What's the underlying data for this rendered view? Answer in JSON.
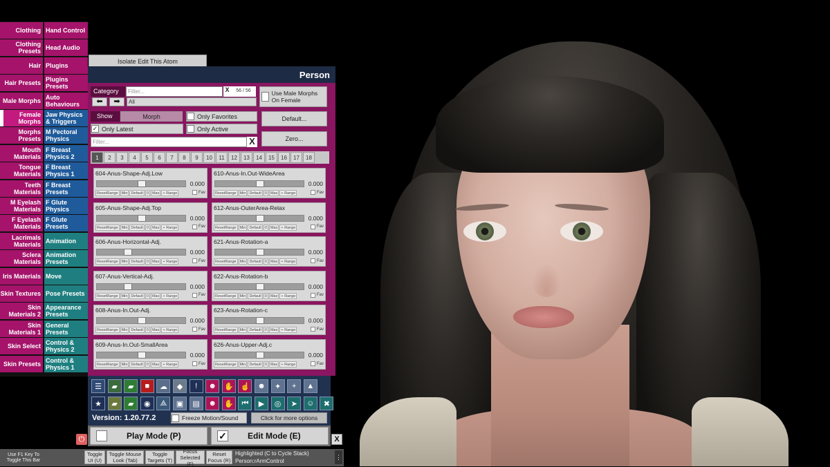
{
  "sidebar_left": [
    {
      "label": "Clothing",
      "color": "mag"
    },
    {
      "label": "Clothing Presets",
      "color": "mag"
    },
    {
      "label": "Hair",
      "color": "mag"
    },
    {
      "label": "Hair Presets",
      "color": "mag"
    },
    {
      "label": "Male Morphs",
      "color": "mag"
    },
    {
      "label": "Female Morphs",
      "color": "mag2"
    },
    {
      "label": "Morphs Presets",
      "color": "mag"
    },
    {
      "label": "Mouth Materials",
      "color": "mag"
    },
    {
      "label": "Tongue Materials",
      "color": "mag"
    },
    {
      "label": "Teeth Materials",
      "color": "mag"
    },
    {
      "label": "M Eyelash Materials",
      "color": "mag"
    },
    {
      "label": "F Eyelash Materials",
      "color": "mag"
    },
    {
      "label": "Lacrimals Materials",
      "color": "mag"
    },
    {
      "label": "Sclera Materials",
      "color": "mag"
    },
    {
      "label": "Iris Materials",
      "color": "mag"
    },
    {
      "label": "Skin Textures",
      "color": "mag"
    },
    {
      "label": "Skin Materials 2",
      "color": "mag"
    },
    {
      "label": "Skin Materials 1",
      "color": "mag"
    },
    {
      "label": "Skin Select",
      "color": "mag"
    },
    {
      "label": "Skin Presets",
      "color": "mag"
    }
  ],
  "sidebar_right": [
    {
      "label": "Hand Control",
      "color": "mag"
    },
    {
      "label": "Head Audio",
      "color": "mag"
    },
    {
      "label": "Plugins",
      "color": "mag"
    },
    {
      "label": "Plugins Presets",
      "color": "mag"
    },
    {
      "label": "Auto Behaviours",
      "color": "mag"
    },
    {
      "label": "Jaw Physics & Triggers",
      "color": "blu"
    },
    {
      "label": "M Pectoral Physics",
      "color": "blu"
    },
    {
      "label": "F Breast Physics 2",
      "color": "blu"
    },
    {
      "label": "F Breast Physics 1",
      "color": "blu"
    },
    {
      "label": "F Breast Presets",
      "color": "blu"
    },
    {
      "label": "F Glute Physics",
      "color": "blu"
    },
    {
      "label": "F Glute Presets",
      "color": "blu"
    },
    {
      "label": "Animation",
      "color": "tea"
    },
    {
      "label": "Animation Presets",
      "color": "tea"
    },
    {
      "label": "Move",
      "color": "tea"
    },
    {
      "label": "Pose Presets",
      "color": "tea"
    },
    {
      "label": "Appearance Presets",
      "color": "tea"
    },
    {
      "label": "General Presets",
      "color": "tea"
    },
    {
      "label": "Control & Physics 2",
      "color": "tea"
    },
    {
      "label": "Control & Physics 1",
      "color": "tea"
    }
  ],
  "isolate_label": "Isolate Edit This Atom",
  "panel": {
    "title": "Person",
    "category_label": "Category",
    "filter_placeholder": "Filter...",
    "filter_clear": "X",
    "count": "56 / 56",
    "category_value": "All",
    "male_morphs_label": "Use Male Morphs On Female",
    "show_label": "Show",
    "morph_label": "Morph",
    "only_favorites": "Only Favorites",
    "only_latest": "Only Latest",
    "only_active": "Only Active",
    "default_btn": "Default...",
    "zero_btn": "Zero...",
    "filter2_placeholder": "Filter...",
    "filter2_clear": "X",
    "pages": [
      "1",
      "2",
      "3",
      "4",
      "5",
      "6",
      "7",
      "8",
      "9",
      "10",
      "11",
      "12",
      "13",
      "14",
      "15",
      "16",
      "17",
      "18"
    ],
    "active_page": "1"
  },
  "morph_sub_labels": [
    "ResetRange",
    "Min",
    "Default",
    "0",
    "Max",
    "+ Range"
  ],
  "fav_label": "Fav",
  "morphs": [
    {
      "name": "604-Anus-Shape-Adj.Low",
      "value": "0.000",
      "pos": 0.5
    },
    {
      "name": "610-Anus-In.Out-WideArea",
      "value": "0.000",
      "pos": 0.5
    },
    {
      "name": "605-Anus-Shape-Adj.Top",
      "value": "0.000",
      "pos": 0.5
    },
    {
      "name": "612-Anus-OuterArea-Relax",
      "value": "0.000",
      "pos": 0.5
    },
    {
      "name": "606-Anus-Horizontal-Adj.",
      "value": "0.000",
      "pos": 0.33
    },
    {
      "name": "621-Anus-Rotation-a",
      "value": "0.000",
      "pos": 0.5
    },
    {
      "name": "607-Anus-Vertical-Adj.",
      "value": "0.000",
      "pos": 0.33
    },
    {
      "name": "622-Anus-Rotation-b",
      "value": "0.000",
      "pos": 0.5
    },
    {
      "name": "608-Anus-In.Out-Adj.",
      "value": "0.000",
      "pos": 0.5
    },
    {
      "name": "623-Anus-Rotation-c",
      "value": "0.000",
      "pos": 0.5
    },
    {
      "name": "609-Anus-In.Out-SmallArea",
      "value": "0.000",
      "pos": 0.5
    },
    {
      "name": "626-Anus-Upper-Adj.c",
      "value": "0.000",
      "pos": 0.5
    }
  ],
  "toolbar_icons": [
    {
      "name": "menu-icon",
      "glyph": "☰"
    },
    {
      "name": "open-scene-icon",
      "glyph": "▰"
    },
    {
      "name": "folder-icon",
      "glyph": "▰"
    },
    {
      "name": "delete-icon",
      "glyph": "■"
    },
    {
      "name": "cloud-icon",
      "glyph": "☁"
    },
    {
      "name": "cube-icon",
      "glyph": "◆"
    },
    {
      "name": "alert-icon",
      "glyph": "!"
    },
    {
      "name": "person-plus-icon",
      "glyph": "☻"
    },
    {
      "name": "hand-icon",
      "glyph": "✋"
    },
    {
      "name": "hand-point-icon",
      "glyph": "☝"
    },
    {
      "name": "person-icon",
      "glyph": "☻"
    },
    {
      "name": "unity-icon",
      "glyph": "✦"
    },
    {
      "name": "add-icon",
      "glyph": "+"
    },
    {
      "name": "build-icon",
      "glyph": "▲"
    },
    {
      "name": "star-icon",
      "glyph": "★"
    },
    {
      "name": "save-folder-icon",
      "glyph": "▰"
    },
    {
      "name": "save-icon",
      "glyph": "▰"
    },
    {
      "name": "camera-icon",
      "glyph": "◉"
    },
    {
      "name": "share-icon",
      "glyph": "⟁"
    },
    {
      "name": "package-icon",
      "glyph": "▣"
    },
    {
      "name": "document-icon",
      "glyph": "▤"
    },
    {
      "name": "person-gear-icon",
      "glyph": "☻"
    },
    {
      "name": "hand-red-icon",
      "glyph": "✋"
    },
    {
      "name": "rewind-icon",
      "glyph": "⏮"
    },
    {
      "name": "play-icon",
      "glyph": "▶"
    },
    {
      "name": "target-icon",
      "glyph": "◎"
    },
    {
      "name": "cursor-icon",
      "glyph": "➤"
    },
    {
      "name": "people-icon",
      "glyph": "☺"
    },
    {
      "name": "tools-icon",
      "glyph": "✖"
    }
  ],
  "version_label": "Version: 1.20.77.2",
  "freeze_label": "Freeze Motion/Sound",
  "more_options_label": "Click for more options",
  "play_mode_label": "Play Mode (P)",
  "edit_mode_label": "Edit Mode (E)",
  "close_label": "X",
  "bottom_bar": {
    "hint": "Use F1 Key To Toggle This Bar",
    "buttons": [
      "Toggle UI (U)",
      "Toggle Mouse Look (Tab)",
      "Toggle Targets (T)",
      "Focus Selected (F)",
      "Reset Focus (R)"
    ],
    "status_line1": "Highlighted (C to Cycle Stack)",
    "status_line2": "Person:rArmControl"
  },
  "colors": {
    "magenta": "#a5136a",
    "blue": "#1f5b9a",
    "teal": "#1f7f80",
    "navy": "#213251",
    "panel_bg": "#8a1560"
  }
}
